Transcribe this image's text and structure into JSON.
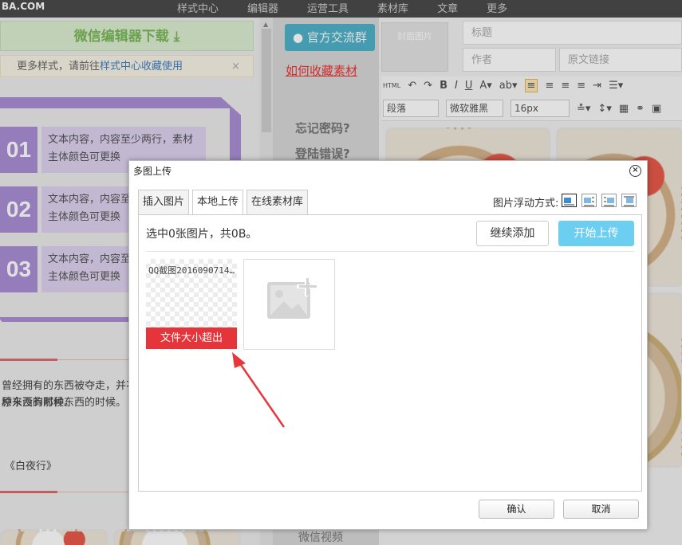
{
  "topbar": {
    "logo": "BA.COM",
    "nav": [
      "样式中心",
      "编辑器",
      "运营工具",
      "素材库",
      "文章",
      "更多"
    ]
  },
  "left": {
    "download_label": "微信编辑器下载",
    "tip_prefix": "更多样式，请前往",
    "tip_link": "样式中心收藏使用",
    "tip_close": "×",
    "items": [
      {
        "num": "01",
        "text": "文本内容，内容至少两行，素材主体颜色可更换"
      },
      {
        "num": "02",
        "text": "文本内容，内容至少两行，素材主体颜色可更换"
      },
      {
        "num": "03",
        "text": "文本内容，内容至少两行，素材主体颜色可更换"
      }
    ],
    "story_line1": "曾经拥有的东西被夺走，并不代表就会回到原来没有那种东西的时候。",
    "story_line2": "原来没有那种东西的时候。",
    "quote": "《白夜行》"
  },
  "middle": {
    "qq_group": "官方交流群",
    "howto": "如何收藏素材",
    "forgot": "忘记密码?",
    "login_error": "登陆错误?",
    "wx_video": "微信视频"
  },
  "editor": {
    "cover_label": "封面图片",
    "title_placeholder": "标题",
    "author_placeholder": "作者",
    "source_placeholder": "原文链接",
    "paragraph": "段落",
    "font": "微软雅黑",
    "size": "16px",
    "html": "HTML"
  },
  "dialog": {
    "title": "多图上传",
    "close": "×",
    "tabs": [
      "插入图片",
      "本地上传",
      "在线素材库"
    ],
    "active_tab": 1,
    "float_label": "图片浮动方式:",
    "status": "选中0张图片，共0B。",
    "continue_label": "继续添加",
    "start_label": "开始上传",
    "file_name": "QQ截图2016090714…",
    "file_error": "文件大小超出",
    "ok_label": "确认",
    "cancel_label": "取消"
  },
  "colors": {
    "accent_blue": "#6ccff2",
    "error_red": "#e5353a",
    "purple": "#a98fd4",
    "annotation_red": "#e8373c"
  }
}
